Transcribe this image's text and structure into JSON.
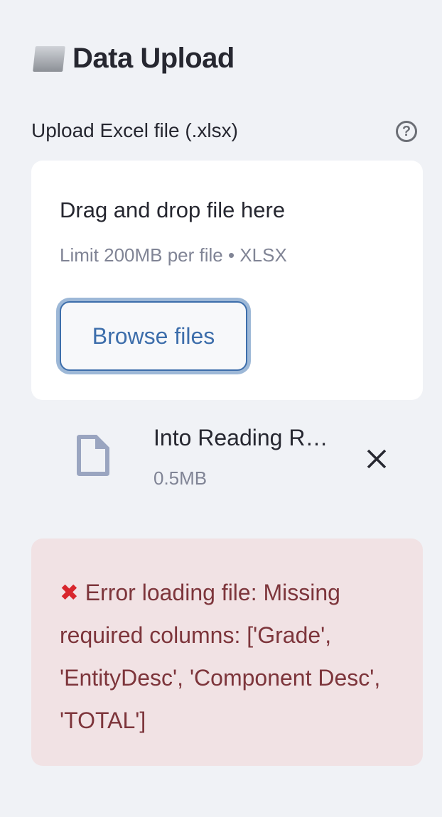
{
  "header": {
    "title": "Data Upload",
    "icon": "folder-icon"
  },
  "uploader": {
    "label": "Upload Excel file (.xlsx)",
    "help_icon": "?",
    "drop_text": "Drag and drop file here",
    "limit_text": "Limit 200MB per file • XLSX",
    "browse_label": "Browse files"
  },
  "file": {
    "name": "Into Reading R…",
    "size": "0.5MB"
  },
  "error": {
    "icon": "✖",
    "message": "Error loading file: Missing required columns: ['Grade', 'EntityDesc', 'Component Desc', 'TOTAL']",
    "color": "#7d353b"
  }
}
